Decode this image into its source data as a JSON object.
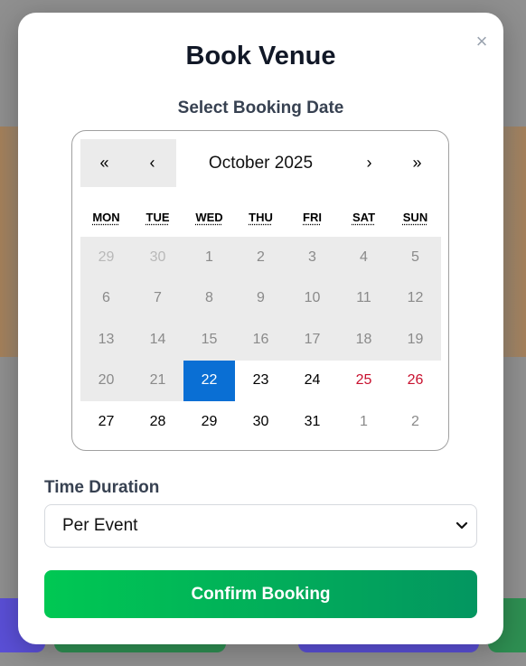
{
  "modal": {
    "title": "Book Venue",
    "close_glyph": "×",
    "subtitle": "Select Booking Date"
  },
  "calendar": {
    "month_label": "October 2025",
    "prev_year": "«",
    "prev_month": "‹",
    "next_month": "›",
    "next_year": "»",
    "weekdays": [
      "MON",
      "TUE",
      "WED",
      "THU",
      "FRI",
      "SAT",
      "SUN"
    ],
    "days": [
      "29",
      "30",
      "1",
      "2",
      "3",
      "4",
      "5",
      "6",
      "7",
      "8",
      "9",
      "10",
      "11",
      "12",
      "13",
      "14",
      "15",
      "16",
      "17",
      "18",
      "19",
      "20",
      "21",
      "22",
      "23",
      "24",
      "25",
      "26",
      "27",
      "28",
      "29",
      "30",
      "31",
      "1",
      "2"
    ],
    "selected_day": "22",
    "colors": {
      "selected": "#0a6fd4",
      "weekend": "#c8102e",
      "disabled_bg": "#ebebeb"
    }
  },
  "duration": {
    "label": "Time Duration",
    "value": "Per Event"
  },
  "actions": {
    "confirm_label": "Confirm Booking"
  },
  "icons": {
    "close": "close-icon",
    "select": "chevron-down-icon"
  }
}
